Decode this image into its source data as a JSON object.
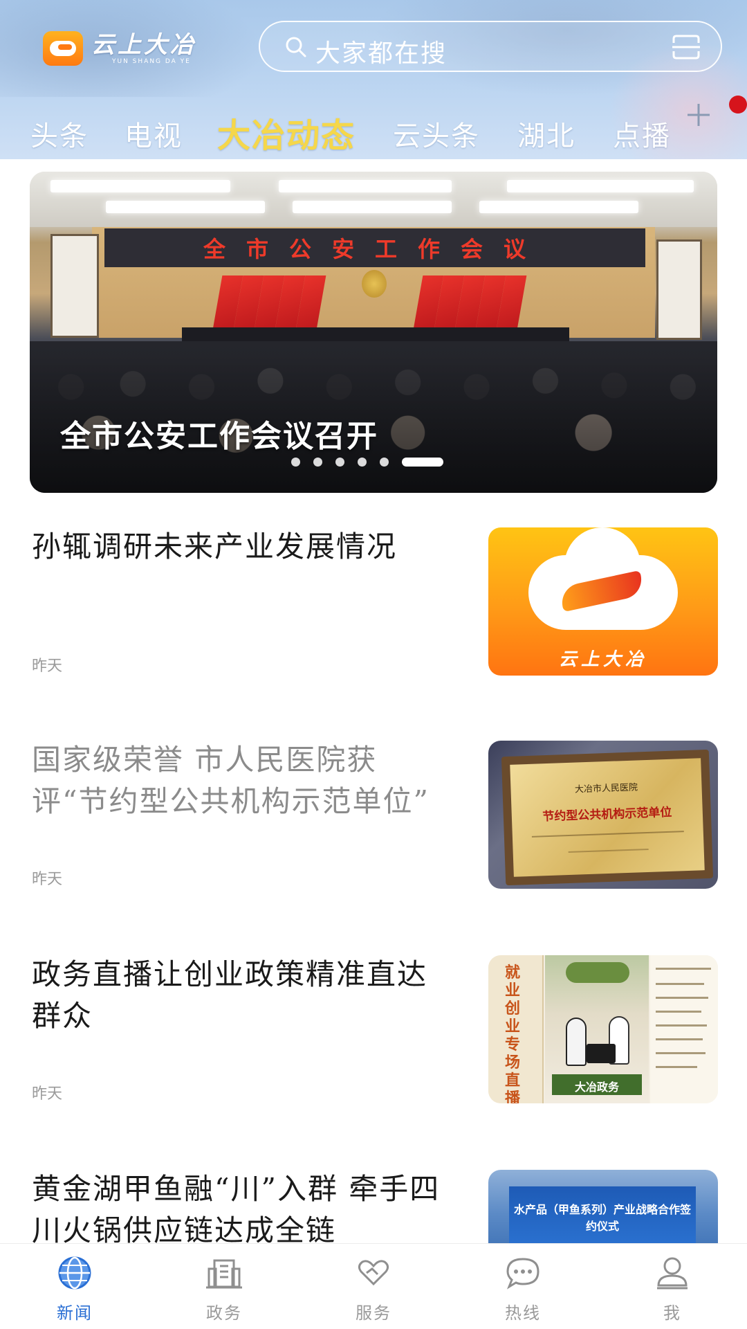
{
  "header": {
    "logo_cn": "云上大冶",
    "logo_en": "YUN SHANG DA YE",
    "search_placeholder": "大家都在搜",
    "tabs": [
      {
        "label": "头条",
        "active": false
      },
      {
        "label": "电视",
        "active": false
      },
      {
        "label": "大冶动态",
        "active": true
      },
      {
        "label": "云头条",
        "active": false
      },
      {
        "label": "湖北",
        "active": false
      },
      {
        "label": "点播",
        "active": false
      }
    ],
    "icons": {
      "search": "search-icon",
      "scan": "scan-icon",
      "add_tab": "plus-icon"
    },
    "colors": {
      "active_tab": "#f5d74b",
      "notification_dot": "#d6141c"
    }
  },
  "banner": {
    "headline": "全市公安工作会议召开",
    "stage_board_text": "全市公安工作会议",
    "slide_count": 6,
    "active_slide": 6
  },
  "news": [
    {
      "title": "孙辄调研未来产业发展情况",
      "time": "昨天",
      "read": false,
      "thumb": {
        "kind": "app-logo",
        "caption": "云上大冶"
      }
    },
    {
      "title": "国家级荣誉 市人民医院获评“节约型公共机构示范单位”",
      "time": "昨天",
      "read": true,
      "thumb": {
        "kind": "plaque",
        "hospital": "大冶市人民医院",
        "plaque_title": "节约型公共机构示范单位"
      }
    },
    {
      "title": "政务直播让创业政策精准直达群众",
      "time": "昨天",
      "read": false,
      "thumb": {
        "kind": "livestream",
        "side_text": "就业创业专场直播",
        "footer_text": "大冶政务"
      }
    },
    {
      "title": "黄金湖甲鱼融“川”入群 牵手四川火锅供应链达成全链",
      "time": "",
      "read": false,
      "thumb": {
        "kind": "expo",
        "screen_text": "水产品（甲鱼系列）产业战略合作签约仪式"
      }
    }
  ],
  "bottom_nav": [
    {
      "label": "新闻",
      "icon": "globe-icon",
      "active": true
    },
    {
      "label": "政务",
      "icon": "building-icon",
      "active": false
    },
    {
      "label": "服务",
      "icon": "heart-hands-icon",
      "active": false
    },
    {
      "label": "热线",
      "icon": "chat-bubble-icon",
      "active": false
    },
    {
      "label": "我",
      "icon": "user-icon",
      "active": false
    }
  ],
  "colors": {
    "nav_active": "#2a6fd4",
    "nav_inactive": "#9a9a9a",
    "read_title": "#8b8b8b"
  }
}
